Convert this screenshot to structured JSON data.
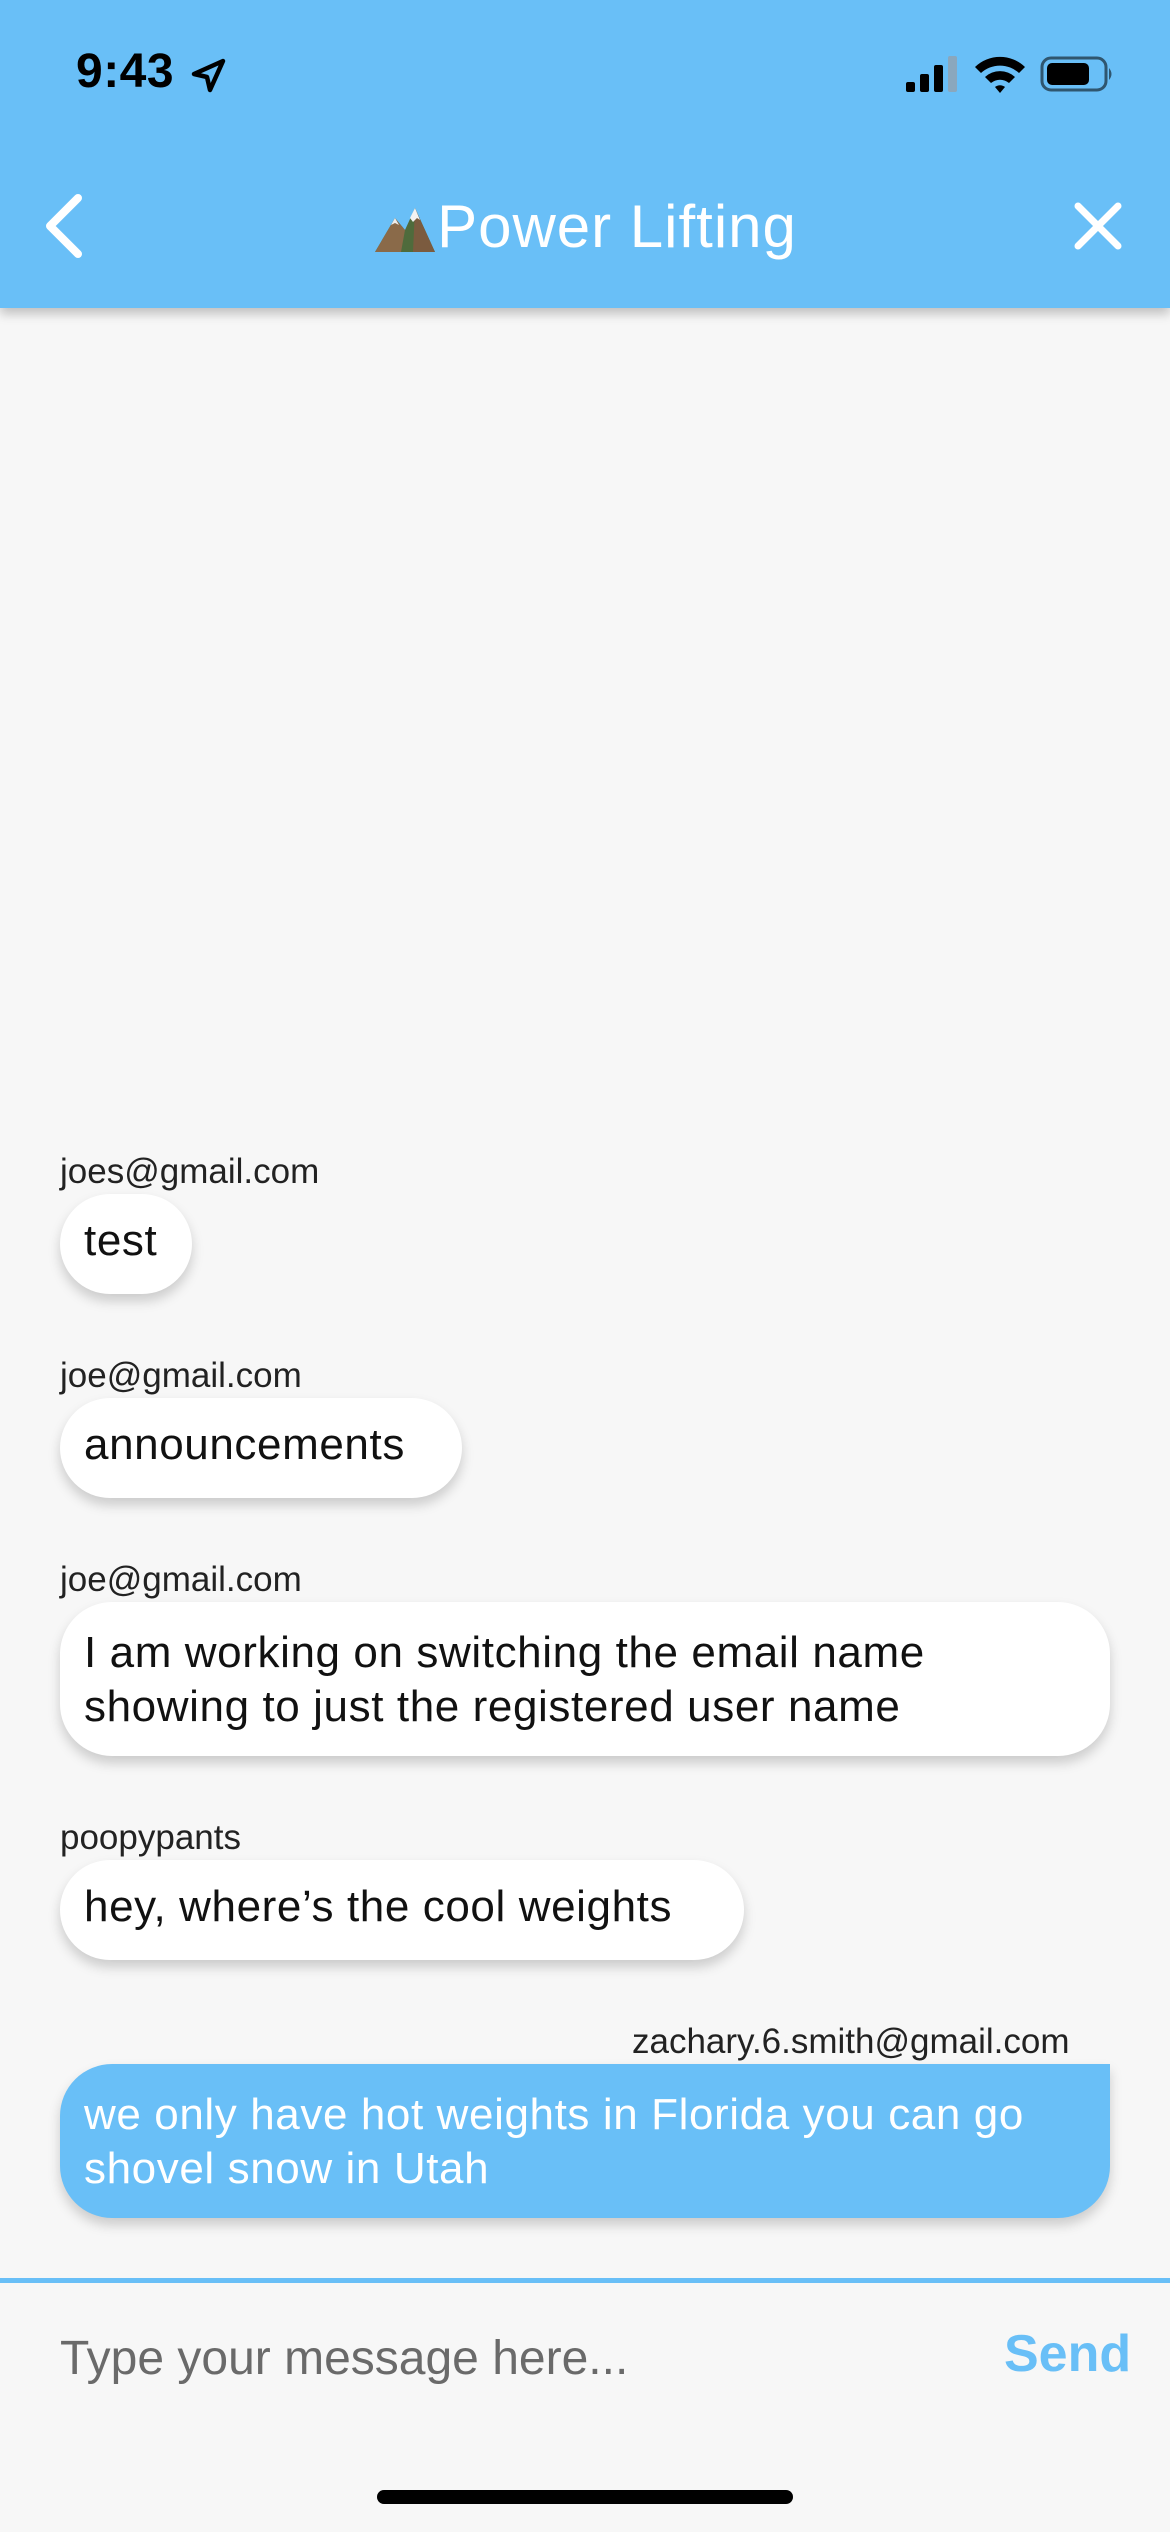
{
  "status_bar": {
    "time": "9:43"
  },
  "header": {
    "title": "Power Lifting",
    "background_color": "#69bff7",
    "back_icon": "chevron-left-icon",
    "close_icon": "close-icon",
    "title_icon": "mountain-icon"
  },
  "messages": [
    {
      "sender": "joes@gmail.com",
      "text": "test",
      "own": false
    },
    {
      "sender": "joe@gmail.com",
      "text": "announcements",
      "own": false
    },
    {
      "sender": "joe@gmail.com",
      "lines": [
        "I am working on switching the email name",
        "showing to just the registered user name"
      ],
      "own": false
    },
    {
      "sender": "poopypants",
      "text": "hey, where’s the cool weights",
      "own": false
    },
    {
      "sender": "zachary.6.smith@gmail.com",
      "lines": [
        "we only have hot weights in Florida you can go",
        "shovel snow in Utah"
      ],
      "own": true
    }
  ],
  "composer": {
    "placeholder": "Type your message here...",
    "send_label": "Send",
    "accent_color": "#69bff7"
  }
}
